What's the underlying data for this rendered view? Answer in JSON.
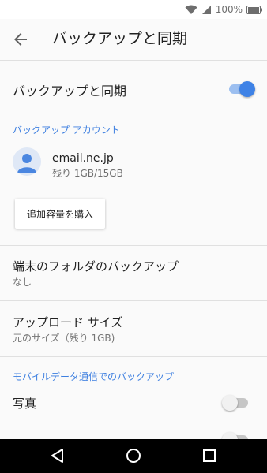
{
  "status_bar": {
    "battery_text": "100%"
  },
  "app_bar": {
    "title": "バックアップと同期"
  },
  "backup_sync": {
    "label": "バックアップと同期",
    "enabled": true
  },
  "account_section": {
    "header": "バックアップ アカウント",
    "email": "email.ne.jp",
    "storage": "残り 1GB/15GB",
    "buy_button": "追加容量を購入"
  },
  "device_folders": {
    "title": "端末のフォルダのバックアップ",
    "value": "なし"
  },
  "upload_size": {
    "title": "アップロード サイズ",
    "value": "元のサイズ（残り 1GB)"
  },
  "mobile_data_section": {
    "header": "モバイルデータ通信でのバックアップ",
    "photos_label": "写真",
    "photos_enabled": false
  },
  "colors": {
    "accent": "#3e82e6",
    "section_header": "#3d7fe0"
  },
  "icons": [
    "wifi-icon",
    "signal-icon",
    "battery-icon",
    "back-arrow-icon",
    "account-avatar-icon",
    "nav-back-icon",
    "nav-home-icon",
    "nav-recents-icon"
  ]
}
